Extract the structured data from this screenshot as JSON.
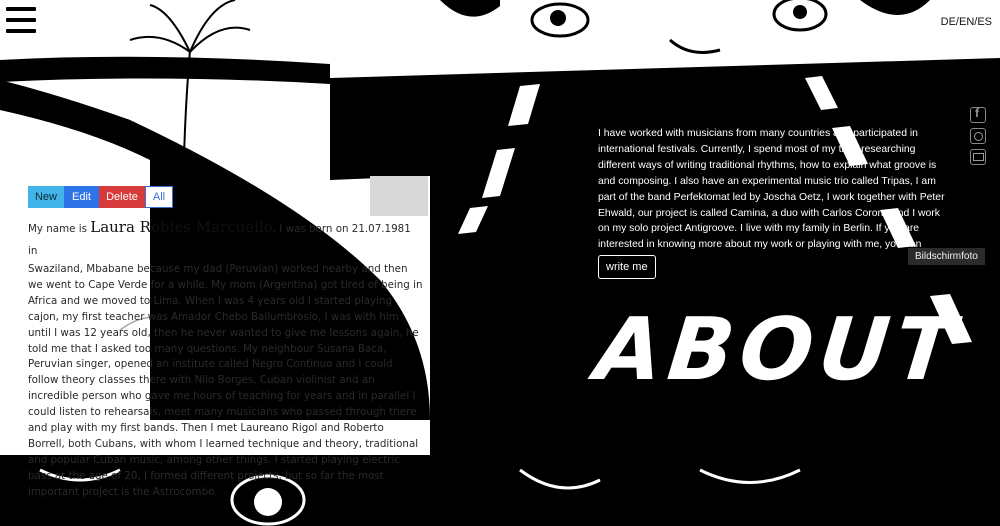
{
  "header": {
    "menu_icon": "hamburger-icon",
    "language_switch": "DE/EN/ES"
  },
  "social": {
    "icons": [
      "facebook-icon",
      "instagram-icon",
      "mail-icon"
    ]
  },
  "cms_toolbar": {
    "new_label": "New",
    "edit_label": "Edit",
    "delete_label": "Delete",
    "all_label": "All"
  },
  "bio": {
    "intro": "My name is",
    "name": "Laura Robles Marcuello",
    "after_name": ", I was born on 21.07.1981 in",
    "body": "Swaziland, Mbabane because my dad (Peruvian) worked nearby and then we went to Cape Verde for a while. My mom (Argentina) got tired of being in Africa and we moved to Lima. When I was 4 years old I started playing cajon, my first teacher was Amador Chebo Ballumbrosio, I was with him until I was 12 years old, then he never wanted to give me lessons again, he told me that I asked too many questions. My neighbour Susana Baca, Peruvian singer, opened an institute called Negro Continuo and I could follow theory classes there with Nilo Borges, Cuban violinist and an incredible person who gave me hours of teaching for years and in parallel I could listen to rehearsals, meet many musicians who passed through there and play with my first bands. Then I met Laureano Rigol and Roberto Borrell, both Cubans, with whom I learned technique and theory, traditional and popular Cuban music, among other things. I started playing electric bass at the age of 20, I formed different projects, but so far the most important project is the Astrocombo."
  },
  "about": {
    "text": "I have worked with musicians from many countries and participated in international festivals. Currently, I spend most of my time researching different ways of writing traditional rhythms, how to explain what groove is and composing. I also have an experimental music trio called Tripas, I am part of the band Perfektomat led by Joscha Oetz, I work together with Peter Ehwald, our project is called Camina, a duo with Carlos Corona and I work on my solo project Antigroove. I live with my family in Berlin. If you are interested in knowing more about my work or playing with me, you can",
    "button_label": "write me",
    "heading": "ABOUT"
  },
  "tooltip": {
    "text": "Bildschirmfoto"
  }
}
